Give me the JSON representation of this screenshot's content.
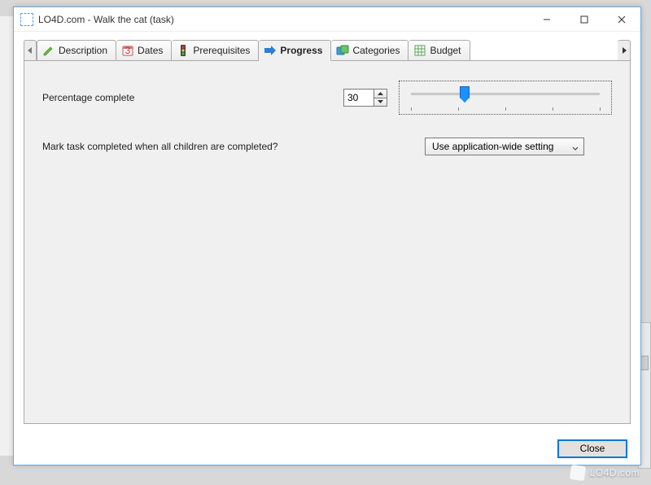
{
  "window": {
    "title": "LO4D.com - Walk the cat (task)"
  },
  "tabs": [
    {
      "label": "Description"
    },
    {
      "label": "Dates"
    },
    {
      "label": "Prerequisites"
    },
    {
      "label": "Progress"
    },
    {
      "label": "Categories"
    },
    {
      "label": "Budget"
    }
  ],
  "active_tab_index": 3,
  "progress": {
    "percentage_label": "Percentage complete",
    "percentage_value": "30",
    "mark_complete_label": "Mark task completed when all children are completed?",
    "mark_complete_value": "Use application-wide setting"
  },
  "buttons": {
    "close": "Close"
  },
  "watermark": "LO4D.com"
}
